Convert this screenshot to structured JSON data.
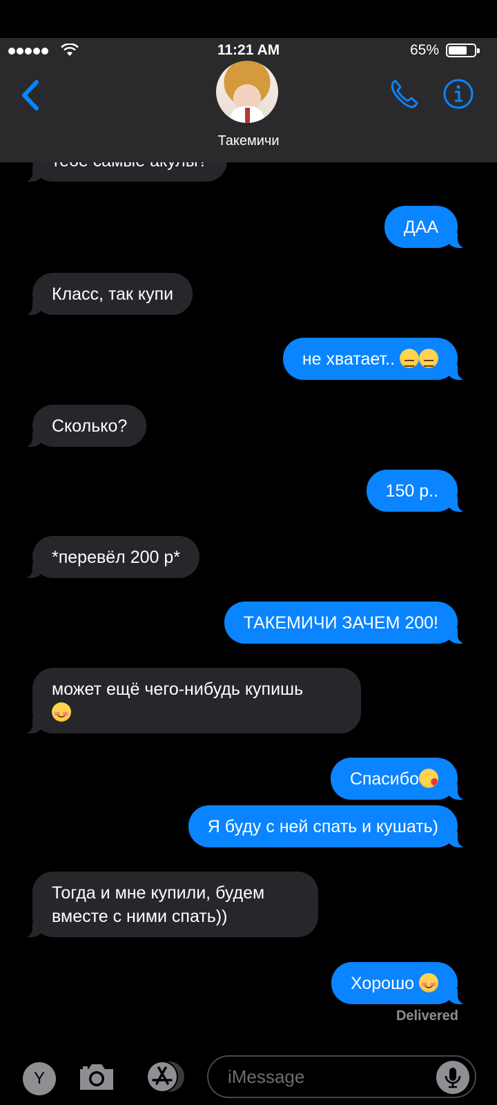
{
  "status_bar": {
    "time": "11:21 AM",
    "battery": "65%"
  },
  "header": {
    "contact_name": "Такемичи"
  },
  "messages": [
    {
      "dir": "in",
      "text": "тебе самые акулы?"
    },
    {
      "dir": "out",
      "text": "ДАА"
    },
    {
      "dir": "in",
      "text": "Класс, так купи"
    },
    {
      "dir": "out",
      "text": "не хватает.. ",
      "emoji": [
        "confounded",
        "confounded"
      ]
    },
    {
      "dir": "in",
      "text": "Сколько?"
    },
    {
      "dir": "out",
      "text": "150 р.."
    },
    {
      "dir": "in",
      "text": "*перевёл 200 р*"
    },
    {
      "dir": "out",
      "text": "ТАКЕМИЧИ ЗАЧЕМ 200!"
    },
    {
      "dir": "in",
      "text": "может ещё чего-нибудь купишь",
      "emoji": [
        "smiling-face"
      ]
    },
    {
      "dir": "out",
      "text": "Спасибо",
      "emoji": [
        "face-blowing-kiss"
      ]
    },
    {
      "dir": "out",
      "text": "Я буду с ней спать и кушать)"
    },
    {
      "dir": "in",
      "text": "Тогда и мне купили, будем вместе с ними спать))"
    },
    {
      "dir": "out",
      "text": "Хорошо ",
      "emoji": [
        "smiling-face"
      ]
    }
  ],
  "delivered": "Delivered",
  "input": {
    "placeholder": "iMessage",
    "user_initial": "Y"
  },
  "colors": {
    "incoming_bubble": "#27262b",
    "outgoing_bubble": "#0b84ff",
    "accent": "#0b84ff"
  }
}
